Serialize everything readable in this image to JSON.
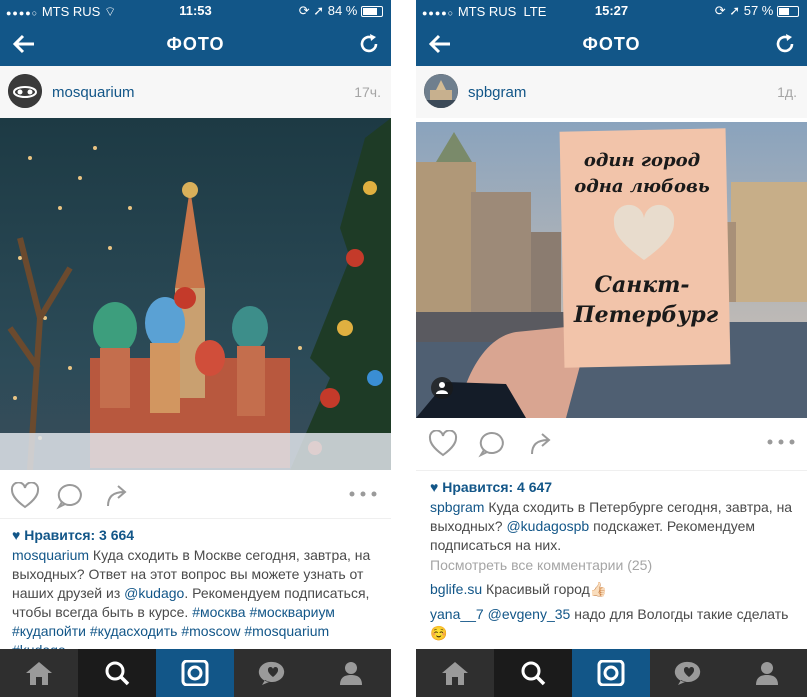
{
  "left": {
    "status": {
      "carrier": "MTS RUS",
      "time": "11:53",
      "battery": "84 %"
    },
    "nav": {
      "title": "ФОТО"
    },
    "post": {
      "username": "mosquarium",
      "time": "17ч.",
      "likes": "Нравится: 3 664",
      "caption_user": "mosquarium",
      "caption_text": "Куда сходить в Москве сегодня, завтра, на выходных? Ответ на этот вопрос вы можете узнать от наших друзей из",
      "caption_mention": "@kudago",
      "caption_text2": ". Рекомендуем подписаться, чтобы всегда быть в курсе.",
      "hashtags": [
        "#москва",
        "#москвариум",
        "#кудапойти",
        "#кудасходить",
        "#moscow",
        "#mosquarium",
        "#kudago"
      ]
    }
  },
  "right": {
    "status": {
      "carrier": "MTS RUS",
      "network": "LTE",
      "time": "15:27",
      "battery": "57 %"
    },
    "nav": {
      "title": "ФОТО"
    },
    "post": {
      "username": "spbgram",
      "time": "1д.",
      "card_lines": [
        "один город",
        "одна любовь",
        "Санкт-",
        "Петербург"
      ],
      "likes": "Нравится: 4 647",
      "caption_user": "spbgram",
      "caption_text": "Куда сходить в Петербурге сегодня, завтра, на выходных?",
      "caption_mention": "@kudagospb",
      "caption_text2": "подскажет. Рекомендуем подписаться на них.",
      "view_all": "Посмотреть все комментарии (25)",
      "comments": [
        {
          "user": "bglife.su",
          "text": "Красивый город👍🏻"
        },
        {
          "user": "yana__7",
          "mention": "@evgeny_35",
          "text": "надо для Вологды такие сделать ☺️"
        }
      ]
    }
  },
  "colors": {
    "brand": "#125688",
    "tabbar": "#2f2f2f",
    "muted": "#a5a5a5"
  },
  "icons": [
    "back-arrow-icon",
    "refresh-icon",
    "heart-icon",
    "comment-icon",
    "share-icon",
    "more-icon",
    "home-icon",
    "search-icon",
    "camera-icon",
    "activity-icon",
    "profile-icon",
    "location-pin-icon",
    "person-tag-icon"
  ]
}
